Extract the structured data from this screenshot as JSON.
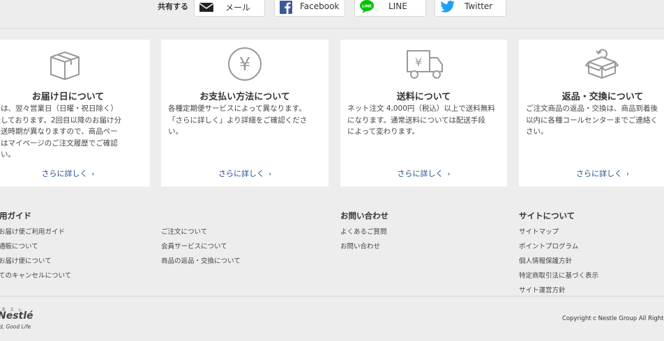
{
  "share": {
    "label": "共有する",
    "buttons": [
      {
        "id": "mail",
        "label": "メール",
        "icon": "mail-icon"
      },
      {
        "id": "facebook",
        "label": "Facebook",
        "icon": "facebook-icon",
        "color": "#3b5998"
      },
      {
        "id": "line",
        "label": "LINE",
        "icon": "line-icon",
        "icon_text": "LINE",
        "color": "#00c300"
      },
      {
        "id": "twitter",
        "label": "Twitter",
        "icon": "twitter-icon",
        "color": "#1da1f2"
      }
    ]
  },
  "cards": [
    {
      "id": "delivery-date",
      "icon": "box-icon",
      "title": "お届け日について",
      "body": "回分は、翌々営業日（日曜・祝日除く）\n発送しております。2回目以降のお届け分\n　発送時期が異なりますので、商品ペー\nまたはマイページのご注文履歴でご確認\nださい。",
      "more": "さらに詳しく",
      "more_arrow": "›"
    },
    {
      "id": "payment",
      "icon": "yen-circle-icon",
      "icon_text": "¥",
      "title": "お支払い方法について",
      "body": "各種定期便サービスによって異なります。\n「さらに詳しく」より詳細をご確認くださ\nい。",
      "more": "さらに詳しく",
      "more_arrow": "›"
    },
    {
      "id": "shipping",
      "icon": "truck-icon",
      "icon_text": "¥",
      "title": "送料について",
      "body": "ネット注文 4,000円（税込）以上で送料無料\nになります。通常送料については配送手段\nによって変わります。",
      "more": "さらに詳しく",
      "more_arrow": "›"
    },
    {
      "id": "returns",
      "icon": "return-box-icon",
      "title": "返品・交換について",
      "body": "ご注文商品の返品・交換は、商品到着後\n以内に各種コールセンターまでご連絡く\nさい。",
      "more": "さらに詳しく",
      "more_arrow": "›"
    }
  ],
  "footer": {
    "col1": {
      "heading": "用ガイド",
      "links": [
        "お届け便ご利用ガイド",
        "通販について",
        "お届け便について",
        "てのキャンセルについて"
      ]
    },
    "col2": {
      "links": [
        "ご注文について",
        "会員サービスについて",
        "商品の返品・交換について"
      ]
    },
    "col3": {
      "heading": "お問い合わせ",
      "links": [
        "よくあるご質問",
        "お問い合わせ"
      ]
    },
    "col4": {
      "heading": "サイトについて",
      "links": [
        "サイトマップ",
        "ポイントプログラム",
        "個人情報保護方針",
        "特定商取引法に基づく表示",
        "サイト運営方針"
      ]
    },
    "logo": {
      "kana": "ネ ス レ",
      "name": "Nestlé",
      "tagline": "d, Good Life"
    },
    "copyright": "Copyright c Nestle Group All Rights"
  }
}
